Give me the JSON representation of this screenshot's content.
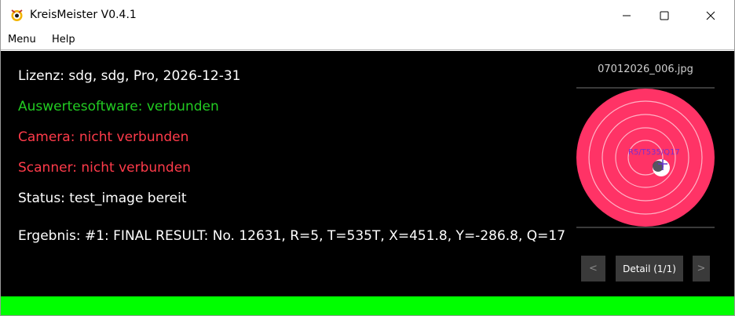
{
  "window": {
    "title": "KreisMeister V0.4.1",
    "app_icon": "kreismeister-logo-icon",
    "controls": {
      "minimize": "minimize-icon",
      "maximize": "maximize-icon",
      "close": "close-icon"
    }
  },
  "menubar": {
    "items": [
      {
        "label": "Menu"
      },
      {
        "label": "Help"
      }
    ]
  },
  "info": {
    "lizenz": "Lizenz: sdg, sdg, Pro, 2026-12-31",
    "auswertesoftware": "Auswertesoftware: verbunden",
    "camera": "Camera: nicht verbunden",
    "scanner": "Scanner: nicht verbunden",
    "status": "Status: test_image bereit",
    "ergebnis": "Ergebnis: #1: FINAL RESULT: No. 12631, R=5, T=535T, X=451.8, Y=-286.8, Q=17"
  },
  "preview": {
    "filename": "07012026_006.jpg",
    "overlay_label": "R5/T535/Q17",
    "target_color": "#ff3366",
    "ring_color": "#ffb3c6"
  },
  "navigation": {
    "prev": "<",
    "detail": "Detail (1/1)",
    "next": ">"
  },
  "colors": {
    "connected": "#22cc22",
    "disconnected": "#ff3b4a",
    "status_bar": "#00ff00",
    "background": "#000000"
  }
}
